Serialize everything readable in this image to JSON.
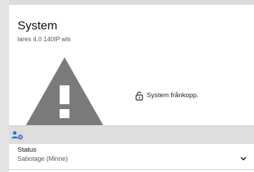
{
  "header": {
    "title": "System",
    "subtitle": "lares 4.0 140IP wls"
  },
  "system": {
    "warning_icon": "warning-triangle-icon",
    "lock_icon": "lock-open-icon",
    "state_text": "System frånkopp."
  },
  "bar": {
    "icon": "user-gear-icon"
  },
  "status_row": {
    "label": "Status",
    "value": "Sabotage (Minne)",
    "chevron_icon": "chevron-down-icon"
  },
  "colors": {
    "warning_gray": "#7a7a7a",
    "accent_blue": "#2f6fd6",
    "bar_gray": "#dddddd"
  }
}
